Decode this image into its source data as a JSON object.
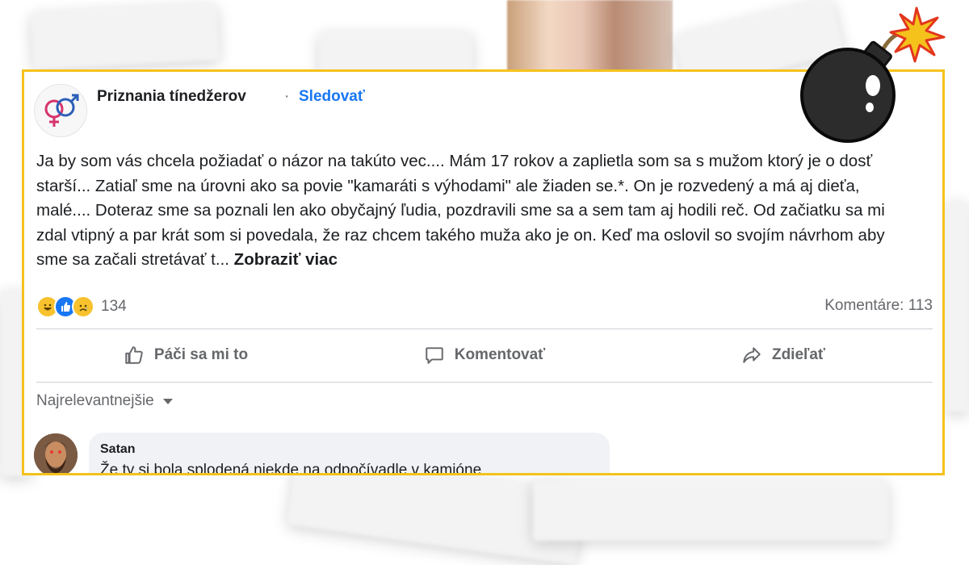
{
  "post": {
    "page_name": "Priznania tínedžerov",
    "separator": "·",
    "follow_label": "Sledovať",
    "text": "Ja by som vás chcela požiadať o názor na takúto vec.... Mám 17 rokov a zaplietla som sa s mužom ktorý je o dosť starší... Zatiaľ sme na úrovni ako sa povie \"kamaráti s výhodami\" ale žiaden se.*. On je rozvedený a má aj dieťa, malé.... Doteraz sme sa poznali len ako obyčajný ľudia, pozdravili sme sa a sem tam aj hodili reč. Od začiatku sa mi zdal vtipný a par krát som si povedala, že raz chcem takého muža ako je on. Keď ma oslovil so svojím návrhom aby sme sa začali stretávať t...",
    "see_more": "Zobraziť viac",
    "reaction_count": "134",
    "comments_count": "Komentáre: 113",
    "reactions": [
      "haha-icon",
      "like-icon",
      "sad-icon"
    ]
  },
  "actions": {
    "like": "Páči sa mi to",
    "comment": "Komentovať",
    "share": "Zdieľať"
  },
  "sort_label": "Najrelevantnejšie",
  "comment": {
    "author": "Satan",
    "text": "Že ty si bola splodená niekde na odpočívadle v kamióne"
  },
  "colors": {
    "frame": "#f5c21b",
    "link": "#1877f2",
    "muted": "#65676b"
  }
}
